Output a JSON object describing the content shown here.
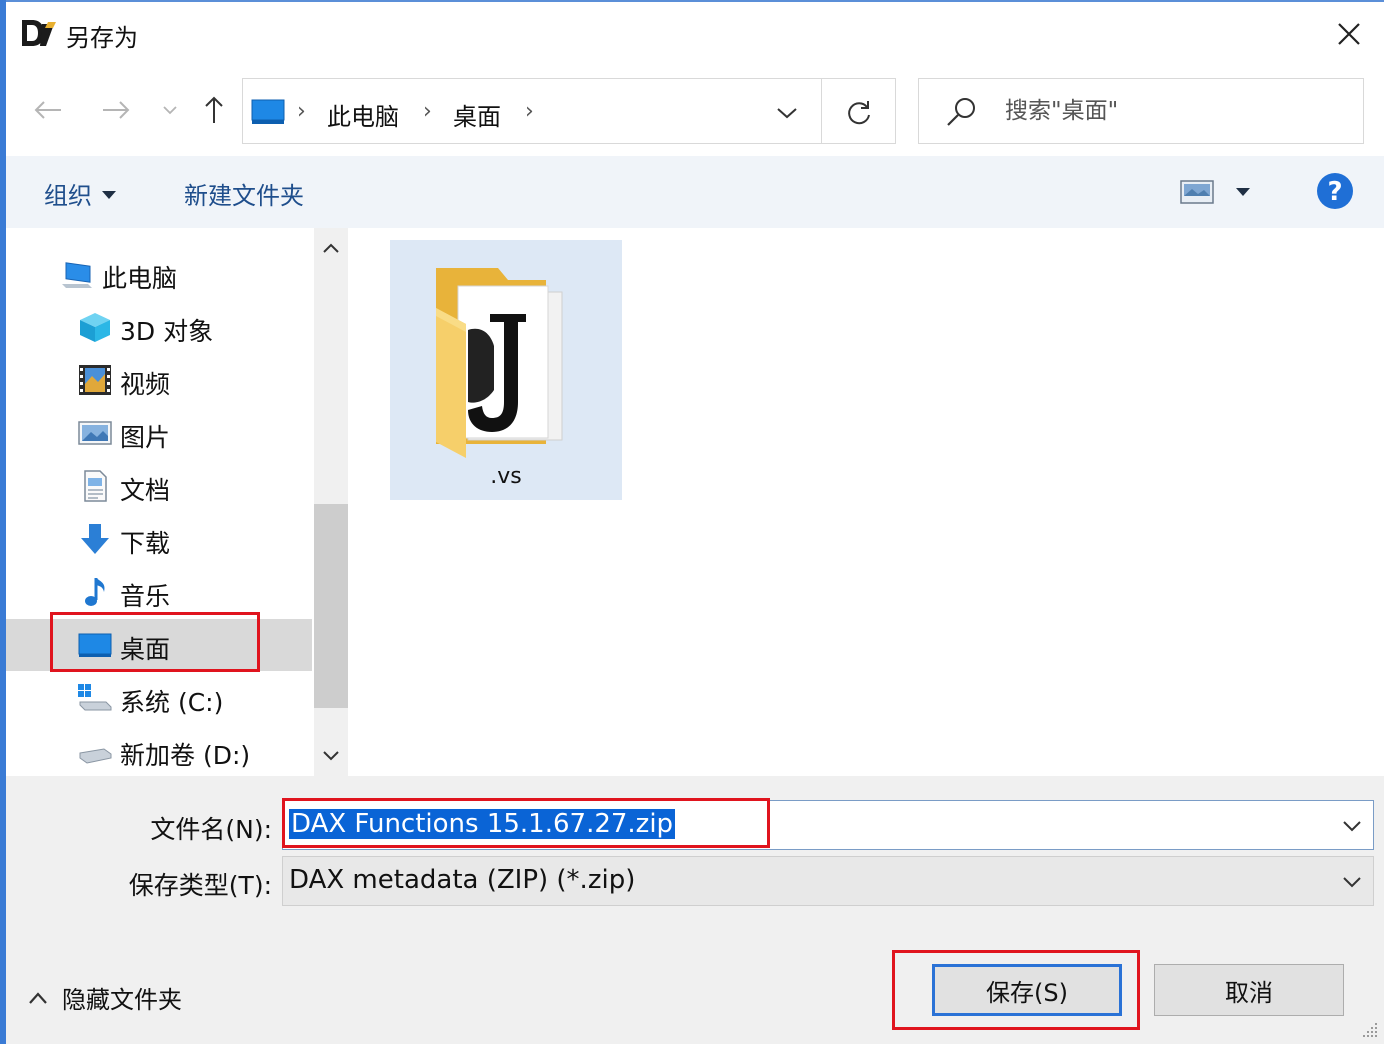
{
  "window": {
    "title": "另存为",
    "close_label": "✕"
  },
  "nav": {
    "back_icon": "arrow-left-icon",
    "forward_icon": "arrow-right-icon",
    "recent_icon": "chevron-down-icon",
    "up_icon": "arrow-up-icon"
  },
  "address": {
    "crumbs": [
      "此电脑",
      "桌面"
    ],
    "separator": "›"
  },
  "search": {
    "placeholder": "搜索\"桌面\""
  },
  "toolbar": {
    "organize_label": "组织",
    "new_folder_label": "新建文件夹",
    "help_label": "?"
  },
  "sidebar": {
    "items": [
      {
        "label": "此电脑",
        "icon": "pc-icon"
      },
      {
        "label": "3D 对象",
        "icon": "cube-icon"
      },
      {
        "label": "视频",
        "icon": "film-icon"
      },
      {
        "label": "图片",
        "icon": "picture-icon"
      },
      {
        "label": "文档",
        "icon": "document-icon"
      },
      {
        "label": "下载",
        "icon": "download-arrow-icon"
      },
      {
        "label": "音乐",
        "icon": "music-note-icon"
      },
      {
        "label": "桌面",
        "icon": "desktop-icon"
      },
      {
        "label": "系统 (C:)",
        "icon": "system-drive-icon"
      },
      {
        "label": "新加卷 (D:)",
        "icon": "drive-icon"
      }
    ],
    "selected": "桌面"
  },
  "content": {
    "files": [
      {
        "name": ".vs",
        "icon": "folder-icon"
      }
    ]
  },
  "form": {
    "filename_label": "文件名(N):",
    "filename_value": "DAX Functions 15.1.67.27.zip",
    "filetype_label": "保存类型(T):",
    "filetype_value": "DAX metadata (ZIP) (*.zip)"
  },
  "buttons": {
    "save_label": "保存(S)",
    "cancel_label": "取消",
    "hide_folders_label": "隐藏文件夹"
  },
  "colors": {
    "accent": "#0a64d6",
    "highlight": "#e0141e",
    "toolbar_bg": "#f0f4f9",
    "link_text": "#1f4e8c"
  }
}
